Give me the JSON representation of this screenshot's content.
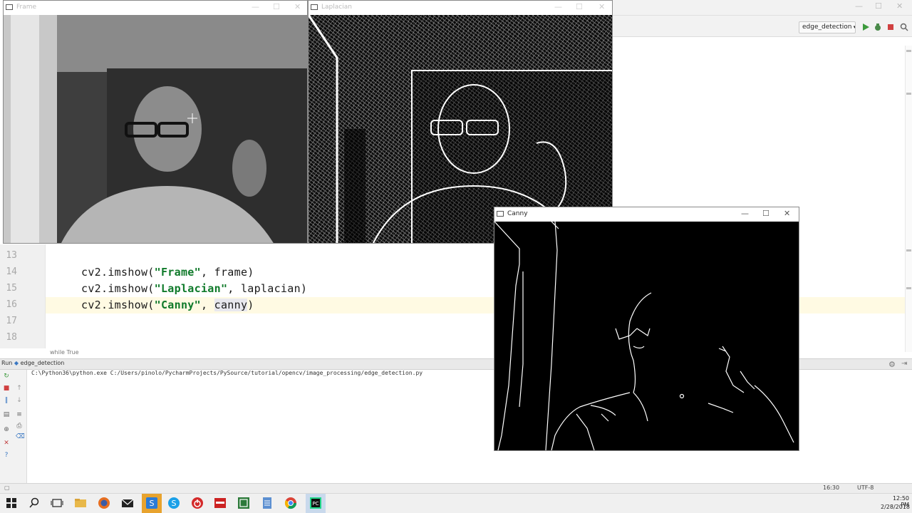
{
  "windows": {
    "frame": {
      "title": "Frame"
    },
    "laplacian": {
      "title": "Laplacian"
    },
    "canny": {
      "title": "Canny"
    }
  },
  "window_controls": {
    "minimize": "—",
    "maximize": "☐",
    "close": "✕"
  },
  "ide": {
    "run_config": "edge_detection",
    "editor": {
      "lines": [
        {
          "number": "13",
          "code": ""
        },
        {
          "number": "14",
          "prefix": "cv2.imshow(",
          "string": "\"Frame\"",
          "suffix": ", frame)"
        },
        {
          "number": "15",
          "prefix": "cv2.imshow(",
          "string": "\"Laplacian\"",
          "suffix": ", laplacian)"
        },
        {
          "number": "16",
          "prefix": "cv2.imshow(",
          "string": "\"Canny\"",
          "mid": ", ",
          "highlight": "canny",
          "suffix": ")"
        },
        {
          "number": "17",
          "code": ""
        },
        {
          "number": "18",
          "code": ""
        }
      ],
      "breadcrumb": "while True"
    },
    "run_panel": {
      "tab_label": "Run",
      "tab_config": "edge_detection",
      "command": "C:\\Python36\\python.exe C:/Users/pinolo/PycharmProjects/PySource/tutorial/opencv/image_processing/edge_detection.py"
    },
    "status": {
      "position": "16:30",
      "encoding": "UTF-8"
    }
  },
  "taskbar": {
    "time": "12:50 PM",
    "date": "2/28/2018",
    "icons": [
      "windows-start-icon",
      "search-icon",
      "task-view-icon",
      "file-explorer-icon",
      "firefox-icon",
      "mail-icon",
      "skype-business-icon",
      "skype-icon",
      "power-icon",
      "red-app-icon",
      "green-app-icon",
      "notepad-icon",
      "chrome-icon",
      "pycharm-icon"
    ]
  },
  "colors": {
    "string_green": "#0f7a2a",
    "current_line": "#fffae3",
    "accent_orange": "#e8a32e"
  }
}
